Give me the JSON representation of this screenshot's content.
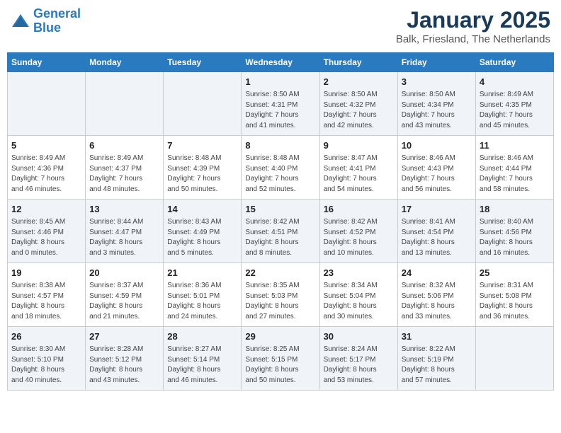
{
  "logo": {
    "line1": "General",
    "line2": "Blue"
  },
  "header": {
    "month": "January 2025",
    "location": "Balk, Friesland, The Netherlands"
  },
  "days_of_week": [
    "Sunday",
    "Monday",
    "Tuesday",
    "Wednesday",
    "Thursday",
    "Friday",
    "Saturday"
  ],
  "weeks": [
    [
      {
        "day": "",
        "info": ""
      },
      {
        "day": "",
        "info": ""
      },
      {
        "day": "",
        "info": ""
      },
      {
        "day": "1",
        "info": "Sunrise: 8:50 AM\nSunset: 4:31 PM\nDaylight: 7 hours\nand 41 minutes."
      },
      {
        "day": "2",
        "info": "Sunrise: 8:50 AM\nSunset: 4:32 PM\nDaylight: 7 hours\nand 42 minutes."
      },
      {
        "day": "3",
        "info": "Sunrise: 8:50 AM\nSunset: 4:34 PM\nDaylight: 7 hours\nand 43 minutes."
      },
      {
        "day": "4",
        "info": "Sunrise: 8:49 AM\nSunset: 4:35 PM\nDaylight: 7 hours\nand 45 minutes."
      }
    ],
    [
      {
        "day": "5",
        "info": "Sunrise: 8:49 AM\nSunset: 4:36 PM\nDaylight: 7 hours\nand 46 minutes."
      },
      {
        "day": "6",
        "info": "Sunrise: 8:49 AM\nSunset: 4:37 PM\nDaylight: 7 hours\nand 48 minutes."
      },
      {
        "day": "7",
        "info": "Sunrise: 8:48 AM\nSunset: 4:39 PM\nDaylight: 7 hours\nand 50 minutes."
      },
      {
        "day": "8",
        "info": "Sunrise: 8:48 AM\nSunset: 4:40 PM\nDaylight: 7 hours\nand 52 minutes."
      },
      {
        "day": "9",
        "info": "Sunrise: 8:47 AM\nSunset: 4:41 PM\nDaylight: 7 hours\nand 54 minutes."
      },
      {
        "day": "10",
        "info": "Sunrise: 8:46 AM\nSunset: 4:43 PM\nDaylight: 7 hours\nand 56 minutes."
      },
      {
        "day": "11",
        "info": "Sunrise: 8:46 AM\nSunset: 4:44 PM\nDaylight: 7 hours\nand 58 minutes."
      }
    ],
    [
      {
        "day": "12",
        "info": "Sunrise: 8:45 AM\nSunset: 4:46 PM\nDaylight: 8 hours\nand 0 minutes."
      },
      {
        "day": "13",
        "info": "Sunrise: 8:44 AM\nSunset: 4:47 PM\nDaylight: 8 hours\nand 3 minutes."
      },
      {
        "day": "14",
        "info": "Sunrise: 8:43 AM\nSunset: 4:49 PM\nDaylight: 8 hours\nand 5 minutes."
      },
      {
        "day": "15",
        "info": "Sunrise: 8:42 AM\nSunset: 4:51 PM\nDaylight: 8 hours\nand 8 minutes."
      },
      {
        "day": "16",
        "info": "Sunrise: 8:42 AM\nSunset: 4:52 PM\nDaylight: 8 hours\nand 10 minutes."
      },
      {
        "day": "17",
        "info": "Sunrise: 8:41 AM\nSunset: 4:54 PM\nDaylight: 8 hours\nand 13 minutes."
      },
      {
        "day": "18",
        "info": "Sunrise: 8:40 AM\nSunset: 4:56 PM\nDaylight: 8 hours\nand 16 minutes."
      }
    ],
    [
      {
        "day": "19",
        "info": "Sunrise: 8:38 AM\nSunset: 4:57 PM\nDaylight: 8 hours\nand 18 minutes."
      },
      {
        "day": "20",
        "info": "Sunrise: 8:37 AM\nSunset: 4:59 PM\nDaylight: 8 hours\nand 21 minutes."
      },
      {
        "day": "21",
        "info": "Sunrise: 8:36 AM\nSunset: 5:01 PM\nDaylight: 8 hours\nand 24 minutes."
      },
      {
        "day": "22",
        "info": "Sunrise: 8:35 AM\nSunset: 5:03 PM\nDaylight: 8 hours\nand 27 minutes."
      },
      {
        "day": "23",
        "info": "Sunrise: 8:34 AM\nSunset: 5:04 PM\nDaylight: 8 hours\nand 30 minutes."
      },
      {
        "day": "24",
        "info": "Sunrise: 8:32 AM\nSunset: 5:06 PM\nDaylight: 8 hours\nand 33 minutes."
      },
      {
        "day": "25",
        "info": "Sunrise: 8:31 AM\nSunset: 5:08 PM\nDaylight: 8 hours\nand 36 minutes."
      }
    ],
    [
      {
        "day": "26",
        "info": "Sunrise: 8:30 AM\nSunset: 5:10 PM\nDaylight: 8 hours\nand 40 minutes."
      },
      {
        "day": "27",
        "info": "Sunrise: 8:28 AM\nSunset: 5:12 PM\nDaylight: 8 hours\nand 43 minutes."
      },
      {
        "day": "28",
        "info": "Sunrise: 8:27 AM\nSunset: 5:14 PM\nDaylight: 8 hours\nand 46 minutes."
      },
      {
        "day": "29",
        "info": "Sunrise: 8:25 AM\nSunset: 5:15 PM\nDaylight: 8 hours\nand 50 minutes."
      },
      {
        "day": "30",
        "info": "Sunrise: 8:24 AM\nSunset: 5:17 PM\nDaylight: 8 hours\nand 53 minutes."
      },
      {
        "day": "31",
        "info": "Sunrise: 8:22 AM\nSunset: 5:19 PM\nDaylight: 8 hours\nand 57 minutes."
      },
      {
        "day": "",
        "info": ""
      }
    ]
  ]
}
